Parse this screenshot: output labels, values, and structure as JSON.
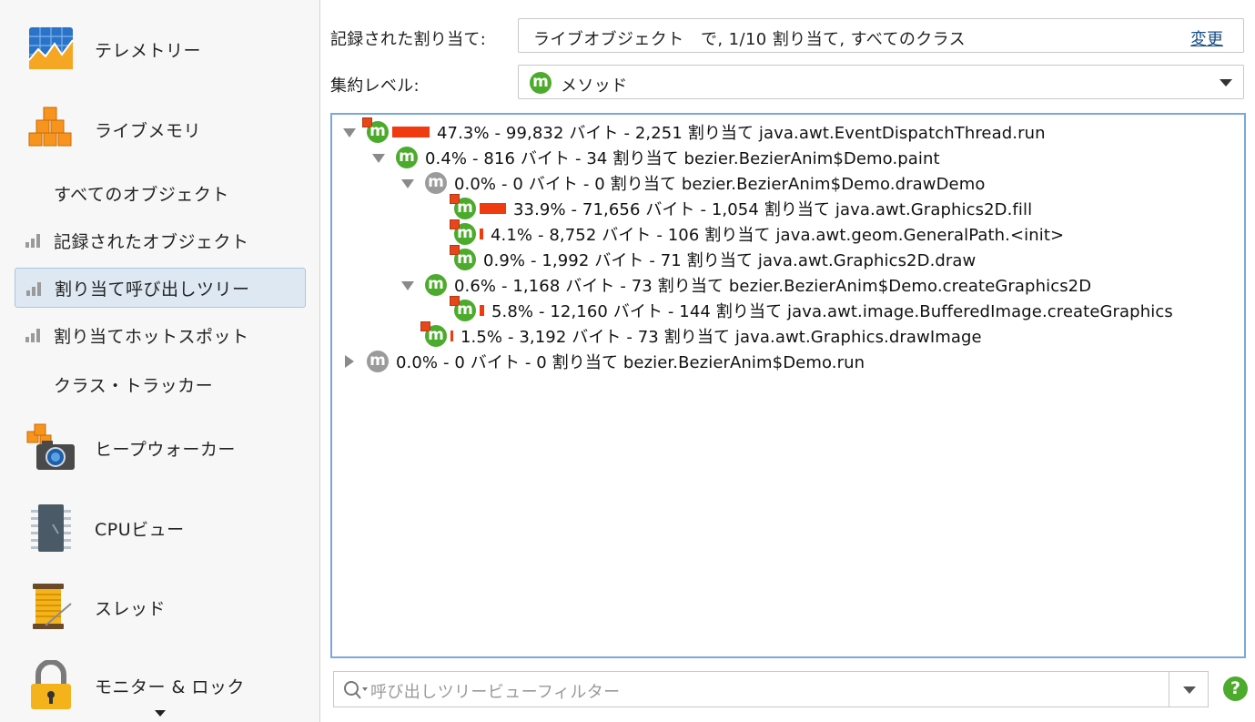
{
  "sidebar": {
    "telemetry": {
      "label": "テレメトリー",
      "icon": "telemetry-chart-icon"
    },
    "live_memory": {
      "label": "ライブメモリ",
      "icon": "orange-cubes-icon"
    },
    "sub_items": [
      {
        "label": "すべてのオブジェクト",
        "icon": ""
      },
      {
        "label": "記録されたオブジェクト",
        "icon": "bar-chart-icon"
      },
      {
        "label": "割り当て呼び出しツリー",
        "icon": "bar-chart-icon",
        "selected": true
      },
      {
        "label": "割り当てホットスポット",
        "icon": "bar-chart-icon"
      },
      {
        "label": "クラス・トラッカー",
        "icon": ""
      }
    ],
    "heap_walker": {
      "label": "ヒープウォーカー",
      "icon": "camera-cubes-icon"
    },
    "cpu": {
      "label": "CPUビュー",
      "icon": "cpu-chip-icon"
    },
    "threads": {
      "label": "スレッド",
      "icon": "thread-spool-icon"
    },
    "monitors": {
      "label": "モニター & ロック",
      "icon": "padlock-icon"
    }
  },
  "header": {
    "recorded_label": "記録された割り当て:",
    "recorded_value": "ライブオブジェクト　で, 1/10 割り当て, すべてのクラス",
    "change_link": "変更",
    "aggregation_label": "集約レベル:",
    "aggregation_value": "メソッド"
  },
  "tree": {
    "rows": [
      {
        "text": "47.3% - 99,832 バイト - 2,251 割り当て java.awt.EventDispatchThread.run",
        "percent": 47.3,
        "state": "open",
        "badge": "green",
        "flag": true
      },
      {
        "text": "0.4% - 816 バイト - 34 割り当て bezier.BezierAnim$Demo.paint",
        "percent": 0.4,
        "state": "open",
        "badge": "green",
        "flag": false
      },
      {
        "text": "0.0% - 0 バイト - 0 割り当て bezier.BezierAnim$Demo.drawDemo",
        "percent": 0.0,
        "state": "open",
        "badge": "gray",
        "flag": false
      },
      {
        "text": "33.9% - 71,656 バイト - 1,054 割り当て java.awt.Graphics2D.fill",
        "percent": 33.9,
        "state": "none",
        "badge": "green",
        "flag": true
      },
      {
        "text": "4.1% - 8,752 バイト - 106 割り当て java.awt.geom.GeneralPath.<init>",
        "percent": 4.1,
        "state": "none",
        "badge": "green",
        "flag": true
      },
      {
        "text": "0.9% - 1,992 バイト - 71 割り当て java.awt.Graphics2D.draw",
        "percent": 0.9,
        "state": "none",
        "badge": "green",
        "flag": true
      },
      {
        "text": "0.6% - 1,168 バイト - 73 割り当て bezier.BezierAnim$Demo.createGraphics2D",
        "percent": 0.6,
        "state": "open",
        "badge": "green",
        "flag": false
      },
      {
        "text": "5.8% - 12,160 バイト - 144 割り当て java.awt.image.BufferedImage.createGraphics",
        "percent": 5.8,
        "state": "none",
        "badge": "green",
        "flag": true
      },
      {
        "text": "1.5% - 3,192 バイト - 73 割り当て java.awt.Graphics.drawImage",
        "percent": 1.5,
        "state": "none",
        "badge": "green",
        "flag": true
      },
      {
        "text": "0.0% - 0 バイト - 0 割り当て bezier.BezierAnim$Demo.run",
        "percent": 0.0,
        "state": "closed",
        "badge": "gray",
        "flag": false
      }
    ]
  },
  "filter": {
    "placeholder": "呼び出しツリービューフィルター"
  },
  "help_label": "?",
  "colors": {
    "accent_green": "#4cab2c",
    "bar_red": "#f03a10",
    "selection": "#dde8f2",
    "tree_border": "#7aa9d9"
  }
}
